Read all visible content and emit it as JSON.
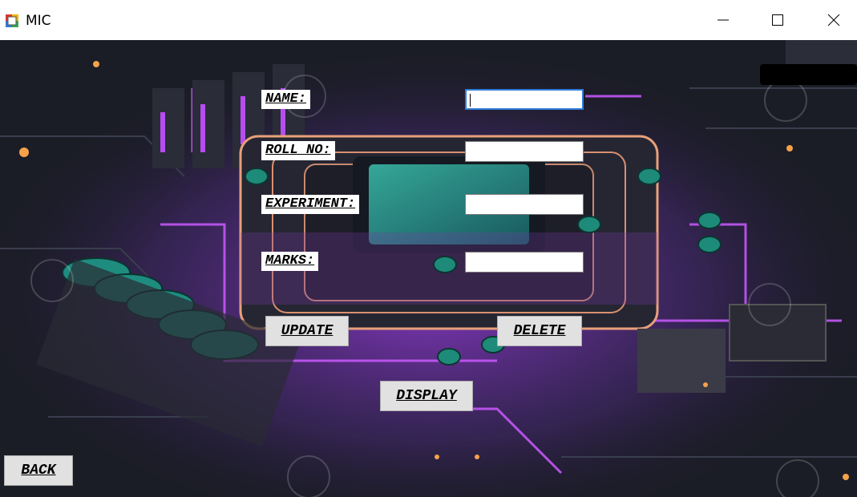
{
  "window": {
    "title": "MIC",
    "icon": "windows-form-icon"
  },
  "controls": {
    "minimize": "minimize-icon",
    "maximize": "maximize-icon",
    "close": "close-icon"
  },
  "form": {
    "name_label": "NAME:",
    "roll_label": "ROLL NO:",
    "experiment_label": "EXPERIMENT:",
    "marks_label": "MARKS:",
    "name_value": "",
    "roll_value": "",
    "experiment_value": "",
    "marks_value": ""
  },
  "buttons": {
    "update": "UPDATE",
    "delete": "DELETE",
    "display": "DISPLAY",
    "back": "BACK"
  },
  "colors": {
    "accent_purple": "#b74cf0",
    "teal": "#3fd6c0",
    "board_dark": "#1b1d26"
  }
}
